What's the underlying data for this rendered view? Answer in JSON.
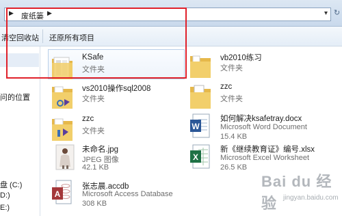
{
  "address": {
    "path_item": "废纸篓"
  },
  "toolbar": {
    "empty_recycle_bin": "清空回收站",
    "restore_all": "还原所有项目"
  },
  "nav": {
    "items": [
      "问的位置",
      "盘 (C:)",
      "D:)",
      "E:)"
    ]
  },
  "files": [
    {
      "name": "KSafe",
      "type": "文件夹",
      "icon": "folder-icon"
    },
    {
      "name": "vb2010练习",
      "type": "文件夹",
      "icon": "folder-icon"
    },
    {
      "name": "vs2010操作sql2008",
      "type": "文件夹",
      "icon": "vs-folder-icon"
    },
    {
      "name": "zzc",
      "type": "文件夹",
      "icon": "folder-icon"
    },
    {
      "name": "zzc",
      "type": "文件夹",
      "icon": "vs-folder-icon"
    },
    {
      "name": "如何解决ksafetray.docx",
      "type": "Microsoft Word Document",
      "size": "15.4 KB",
      "icon": "word-doc-icon"
    },
    {
      "name": "未命名.jpg",
      "type": "JPEG 图像",
      "size": "42.1 KB",
      "icon": "jpeg-thumbnail-icon"
    },
    {
      "name": "新《继续教育证》编号.xlsx",
      "type": "Microsoft Excel Worksheet",
      "size": "26.5 KB",
      "icon": "excel-sheet-icon"
    },
    {
      "name": "张志晨.accdb",
      "type": "Microsoft Access Database",
      "size": "308 KB",
      "icon": "access-db-icon"
    }
  ],
  "watermark": {
    "text": "Bai du 经验",
    "url": "jingyan.baidu.com"
  },
  "colors": {
    "highlight": "#e0202a",
    "folder": "#f2cf6b",
    "word": "#2b5797",
    "excel": "#1e7145",
    "access": "#a4373a"
  }
}
